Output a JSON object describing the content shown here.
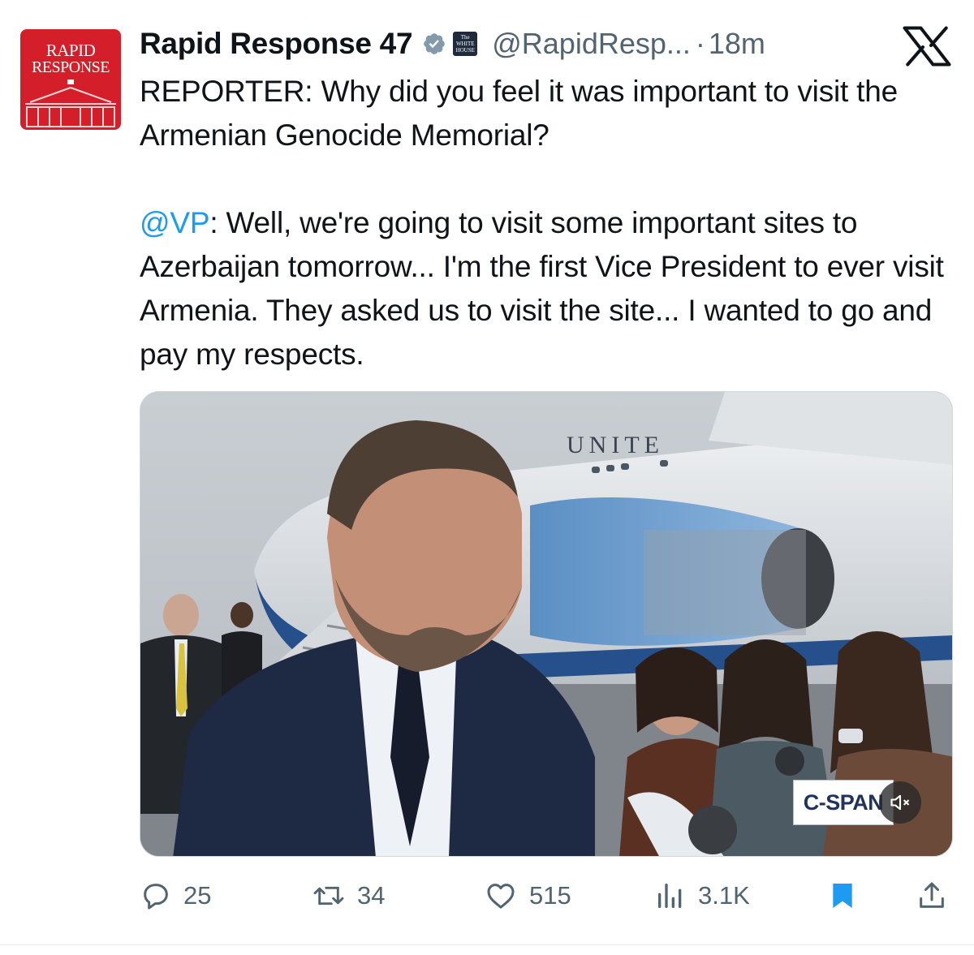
{
  "colors": {
    "accent": "#1d9bf0",
    "secondary_text": "#536471",
    "avatar_red": "#d41f2a",
    "bookmark_active": "#1d9bf0"
  },
  "author": {
    "avatar_text_line1": "RAPID",
    "avatar_text_line2": "RESPONSE",
    "display_name": "Rapid Response 47",
    "verified_icon": "verified-badge-icon",
    "affiliation_badge": {
      "line1": "The",
      "line2": "WHITE",
      "line3": "HOUSE"
    },
    "handle": "@RapidResp...",
    "separator": "·",
    "time": "18m"
  },
  "platform_logo": "x-logo-icon",
  "tweet": {
    "line1": "REPORTER: Why did you feel it was important to visit the Armenian Genocide Memorial?",
    "mention": "@VP",
    "line2": ": Well, we're going to visit some important sites to Azerbaijan tomorrow... I'm the first Vice President to ever visit Armenia. They asked us to visit the site... I wanted to go and pay my respects."
  },
  "media": {
    "plane_text": "UNITE",
    "broadcaster": "C-SPAN",
    "mute_icon": "speaker-muted-icon"
  },
  "actions": {
    "replies": "25",
    "reposts": "34",
    "likes": "515",
    "views": "3.1K",
    "bookmark_icon": "bookmark-icon",
    "share_icon": "share-icon"
  }
}
